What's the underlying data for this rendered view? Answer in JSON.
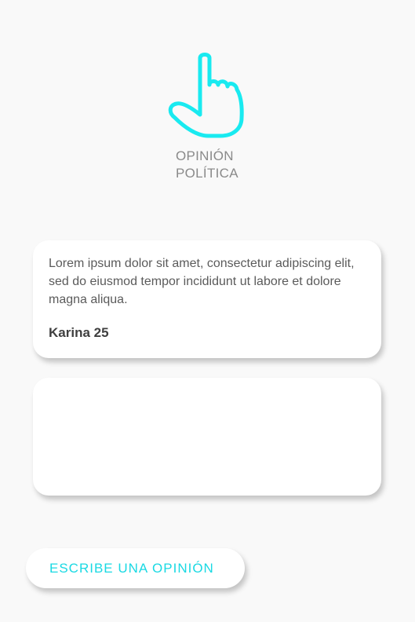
{
  "app": {
    "title_line1": "OPINIÓN",
    "title_line2": "POLÍTICA",
    "logo_icon": "pointing-hand-icon",
    "accent_color": "#19d9e3"
  },
  "opinions": [
    {
      "text": "Lorem ipsum dolor sit amet, consectetur adipiscing elit, sed do eiusmod tempor incididunt ut labore et dolore magna aliqua.",
      "author": "Karina 25"
    },
    {
      "text": "",
      "author": ""
    }
  ],
  "cta": {
    "label": "ESCRIBE UNA OPINIÓN"
  }
}
